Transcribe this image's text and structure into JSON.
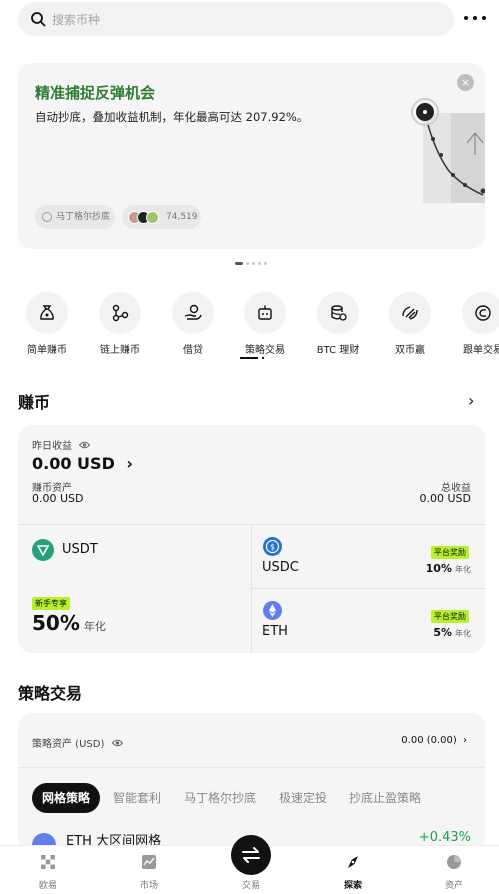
{
  "search": {
    "placeholder": "搜索币种"
  },
  "banner": {
    "title": "精准捕捉反弹机会",
    "subtitle": "自动抄底，叠加收益机制，年化最高可达 207.92%。",
    "chip_strategy": "马丁格尔抄底",
    "chip_users": "74,519",
    "close_label": "×"
  },
  "quick": [
    {
      "label": "简单赚币",
      "icon": "money-bag-icon"
    },
    {
      "label": "链上赚币",
      "icon": "chain-nodes-icon"
    },
    {
      "label": "借贷",
      "icon": "hand-coin-icon"
    },
    {
      "label": "策略交易",
      "icon": "bot-icon"
    },
    {
      "label": "BTC 理财",
      "icon": "coin-stack-icon"
    },
    {
      "label": "双币赢",
      "icon": "dual-currency-icon"
    },
    {
      "label": "跟单交易",
      "icon": "copy-trade-icon"
    }
  ],
  "earn": {
    "title": "赚币",
    "yesterday_label": "昨日收益",
    "yesterday_value": "0.00 USD",
    "assets_label": "赚币资产",
    "assets_value": "0.00 USD",
    "total_label": "总收益",
    "total_value": "0.00 USD",
    "usdt": {
      "name": "USDT",
      "badge": "新手专享",
      "pct": "50%",
      "unit": "年化"
    },
    "usdc": {
      "name": "USDC",
      "badge": "平台奖励",
      "pct": "10%",
      "unit": "年化"
    },
    "eth": {
      "name": "ETH",
      "badge": "平台奖励",
      "pct": "5%",
      "unit": "年化"
    }
  },
  "strategy": {
    "title": "策略交易",
    "assets_label": "策略资产 (USD)",
    "assets_value": "0.00 (0.00)",
    "tabs": [
      "网格策略",
      "智能套利",
      "马丁格尔抄底",
      "极速定投",
      "抄底止盈策略"
    ],
    "row_name": "ETH 大区间网格",
    "row_pct": "+0.43%"
  },
  "nav": [
    {
      "label": "欧易"
    },
    {
      "label": "市场"
    },
    {
      "label": "交易"
    },
    {
      "label": "探索"
    },
    {
      "label": "资产"
    }
  ],
  "colors": {
    "accent_green": "#2e7d32",
    "badge_lime": "#b6f22b",
    "positive": "#17a34a"
  }
}
